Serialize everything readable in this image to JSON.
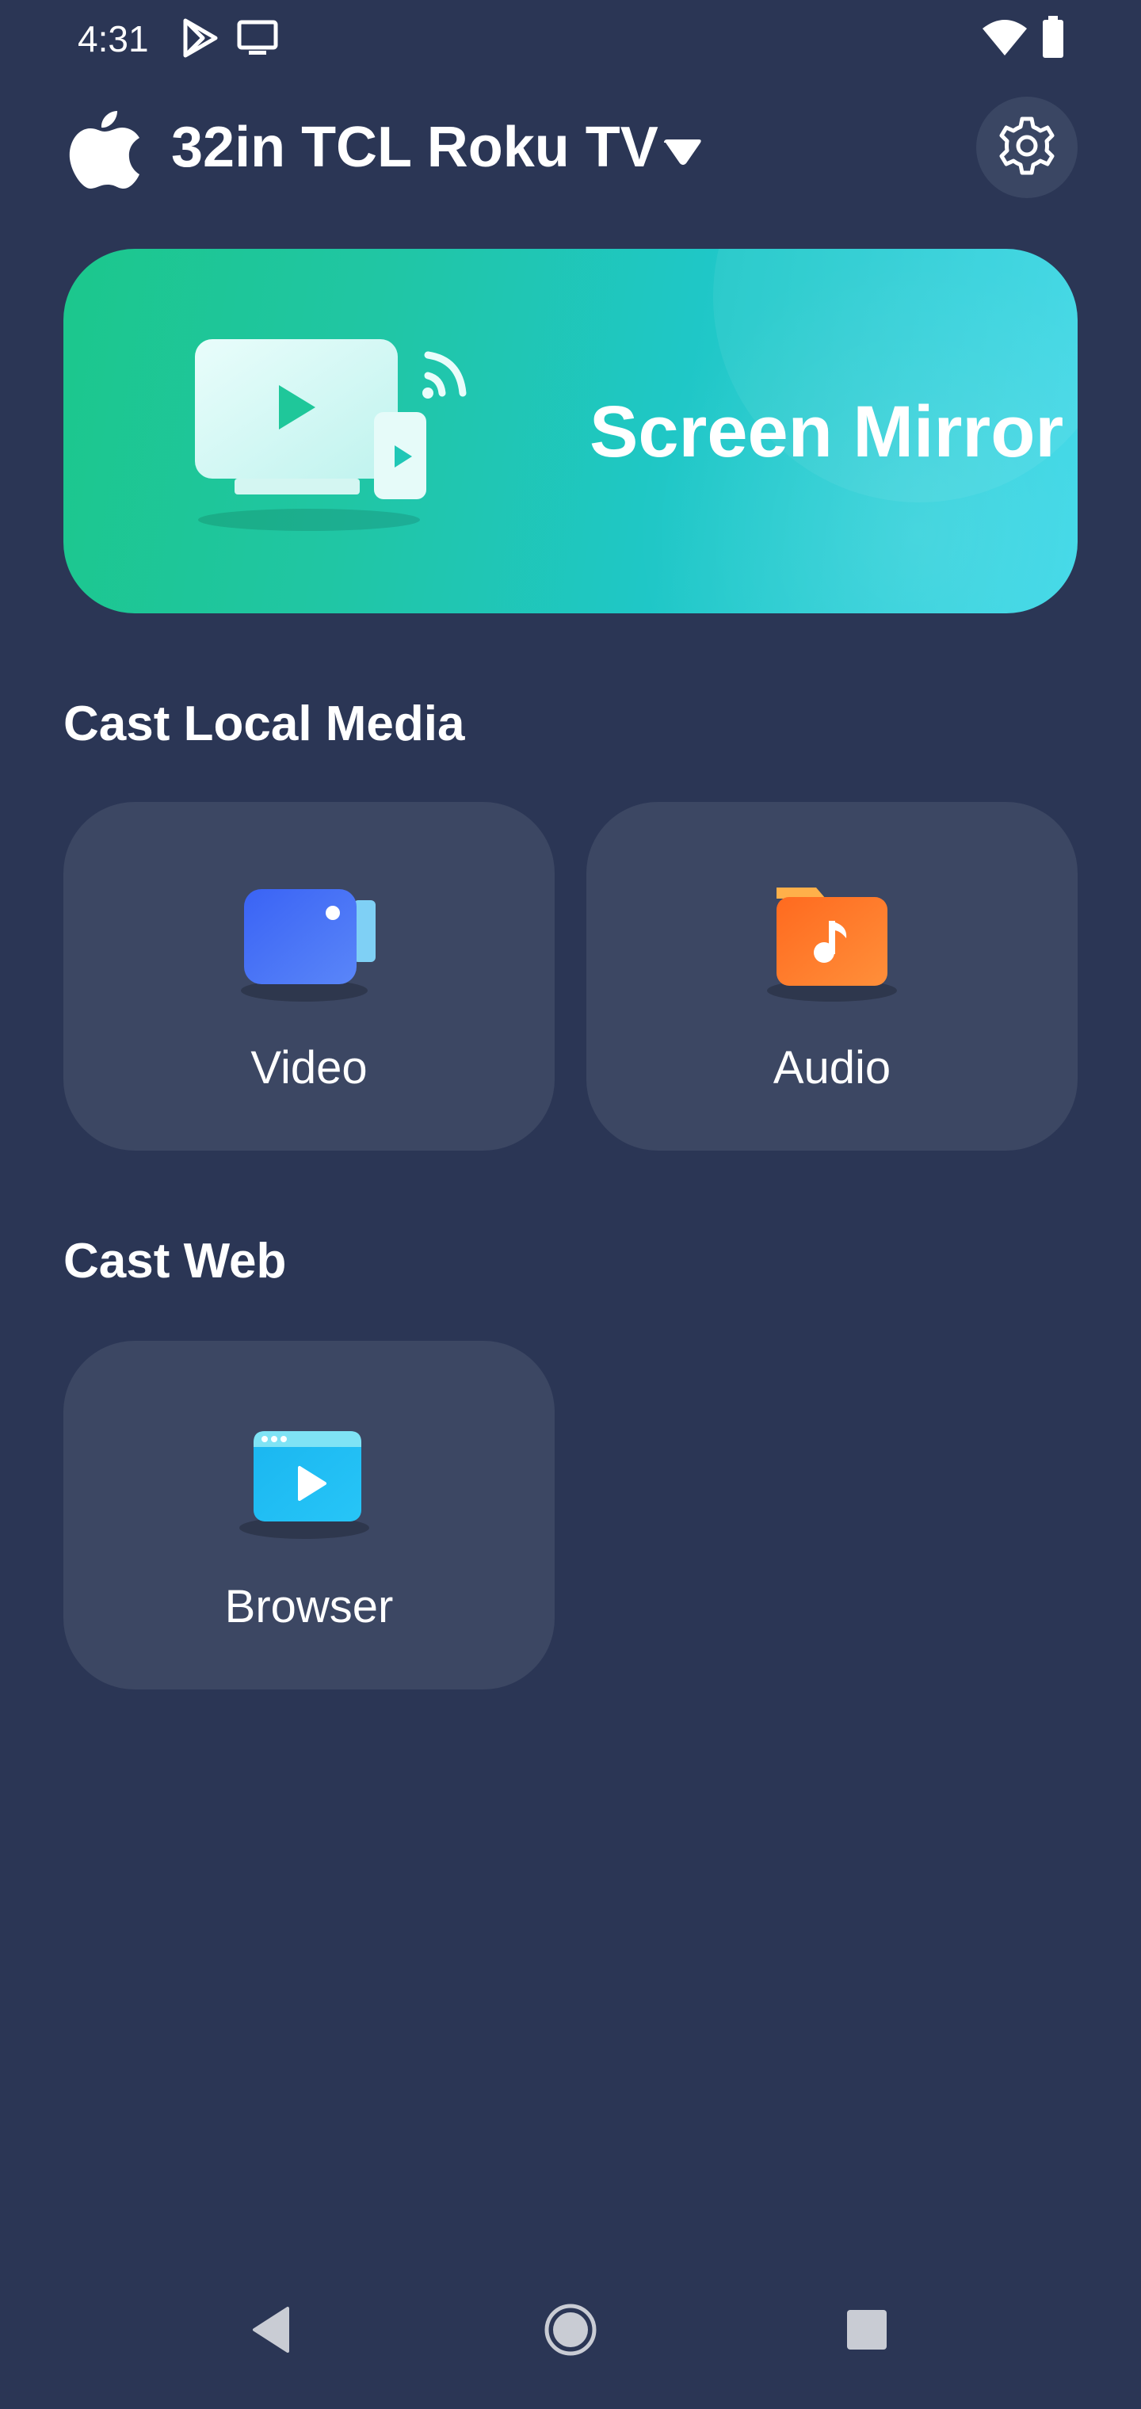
{
  "status_bar": {
    "time": "4:31",
    "icons": [
      "play-store-icon",
      "cast-screen-icon",
      "wifi-icon",
      "battery-icon"
    ]
  },
  "header": {
    "device_name": "32in TCL Roku TV",
    "brand_icon": "apple-icon",
    "dropdown_icon": "caret-down-icon",
    "settings_icon": "gear-icon"
  },
  "mirror": {
    "label": "Screen Mirror",
    "icon": "tv-phone-cast-icon"
  },
  "cast_local": {
    "title": "Cast Local Media",
    "video_label": "Video",
    "video_icon": "video-camera-icon",
    "audio_label": "Audio",
    "audio_icon": "music-folder-icon"
  },
  "cast_web": {
    "title": "Cast Web",
    "browser_label": "Browser",
    "browser_icon": "browser-play-icon"
  },
  "colors": {
    "background": "#2b3655",
    "tile": "#3c4763",
    "mirror_gradient_start": "#1cc78c",
    "mirror_gradient_end": "#3fd8e8"
  }
}
